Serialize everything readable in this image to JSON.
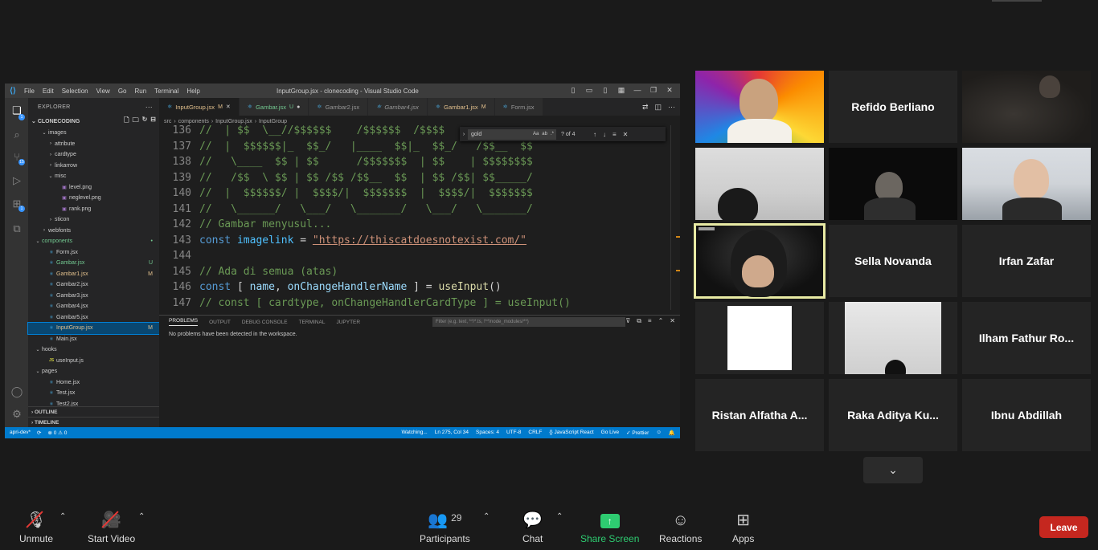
{
  "vscode": {
    "menu": [
      "File",
      "Edit",
      "Selection",
      "View",
      "Go",
      "Run",
      "Terminal",
      "Help"
    ],
    "window_title": "InputGroup.jsx - clonecoding - Visual Studio Code",
    "explorer_title": "EXPLORER",
    "project": "CLONECODING",
    "tree": [
      {
        "label": "images",
        "depth": 2,
        "kind": "folder-open"
      },
      {
        "label": "attribute",
        "depth": 3,
        "kind": "folder"
      },
      {
        "label": "cardtype",
        "depth": 3,
        "kind": "folder"
      },
      {
        "label": "linkarrow",
        "depth": 3,
        "kind": "folder"
      },
      {
        "label": "misc",
        "depth": 3,
        "kind": "folder-open"
      },
      {
        "label": "level.png",
        "depth": 4,
        "kind": "png"
      },
      {
        "label": "neglevel.png",
        "depth": 4,
        "kind": "png"
      },
      {
        "label": "rank.png",
        "depth": 4,
        "kind": "png"
      },
      {
        "label": "sticon",
        "depth": 3,
        "kind": "folder"
      },
      {
        "label": "webfonts",
        "depth": 2,
        "kind": "folder"
      },
      {
        "label": "components",
        "depth": 1,
        "kind": "folder-open",
        "status": "•",
        "state": "folder-mod"
      },
      {
        "label": "Form.jsx",
        "depth": 2,
        "kind": "jsx"
      },
      {
        "label": "Gambar.jsx",
        "depth": 2,
        "kind": "jsx",
        "status": "U",
        "state": "unt"
      },
      {
        "label": "Gambar1.jsx",
        "depth": 2,
        "kind": "jsx",
        "status": "M",
        "state": "mod"
      },
      {
        "label": "Gambar2.jsx",
        "depth": 2,
        "kind": "jsx"
      },
      {
        "label": "Gambar3.jsx",
        "depth": 2,
        "kind": "jsx"
      },
      {
        "label": "Gambar4.jsx",
        "depth": 2,
        "kind": "jsx"
      },
      {
        "label": "Gambar5.jsx",
        "depth": 2,
        "kind": "jsx"
      },
      {
        "label": "InputGroup.jsx",
        "depth": 2,
        "kind": "jsx",
        "status": "M",
        "state": "selected"
      },
      {
        "label": "Main.jsx",
        "depth": 2,
        "kind": "jsx"
      },
      {
        "label": "hooks",
        "depth": 1,
        "kind": "folder-open"
      },
      {
        "label": "useInput.js",
        "depth": 2,
        "kind": "js"
      },
      {
        "label": "pages",
        "depth": 1,
        "kind": "folder-open"
      },
      {
        "label": "Home.jsx",
        "depth": 2,
        "kind": "jsx"
      },
      {
        "label": "Test.jsx",
        "depth": 2,
        "kind": "jsx"
      },
      {
        "label": "Test2.jsx",
        "depth": 2,
        "kind": "jsx"
      }
    ],
    "outline": "OUTLINE",
    "timeline": "TIMELINE",
    "tabs": [
      {
        "label": "InputGroup.jsx",
        "mark": "M",
        "state": "active"
      },
      {
        "label": "Gambar.jsx",
        "mark": "U",
        "state": "unt"
      },
      {
        "label": "Gambar2.jsx",
        "mark": "",
        "state": ""
      },
      {
        "label": "Gambar4.jsx",
        "mark": "",
        "state": "ital"
      },
      {
        "label": "Gambar1.jsx",
        "mark": "M",
        "state": "mod"
      },
      {
        "label": "Form.jsx",
        "mark": "",
        "state": ""
      }
    ],
    "breadcrumb": [
      "src",
      "components",
      "InputGroup.jsx",
      "InputGroup"
    ],
    "find": {
      "query": "gold",
      "count": "? of 4"
    },
    "code_lines": [
      {
        "n": "136",
        "text": "//  | $$  \\__//$$$$$$    /$$$$$$  /$$$$"
      },
      {
        "n": "137",
        "text": "//  |  $$$$$$|_  $$_/   |____  $$|_  $$_/   /$$__  $$"
      },
      {
        "n": "138",
        "text": "//   \\____  $$ | $$      /$$$$$$$  | $$    | $$$$$$$$"
      },
      {
        "n": "139",
        "text": "//   /$$  \\ $$ | $$ /$$ /$$__  $$  | $$ /$$| $$_____/"
      },
      {
        "n": "140",
        "text": "//  |  $$$$$$/ |  $$$$/|  $$$$$$$  |  $$$$/|  $$$$$$$"
      },
      {
        "n": "141",
        "text": "//   \\______/   \\___/   \\_______/   \\___/   \\_______/"
      },
      {
        "n": "142",
        "text": "// Gambar menyusul..."
      },
      {
        "n": "144",
        "text": ""
      },
      {
        "n": "145",
        "text": "// Ada di semua (atas)"
      },
      {
        "n": "147",
        "text": "// const [ cardtype, onChangeHandlerCardType ] = useInput()"
      }
    ],
    "line143": {
      "n": "143",
      "kw": "const",
      "var": "imagelink",
      "op": " = ",
      "str": "\"https://thiscatdoesnotexist.com/\""
    },
    "line146": {
      "n": "146",
      "kw": "const",
      "p1": " [ ",
      "a": "name",
      "p2": ", ",
      "b": "onChangeHandlerName",
      "p3": " ] = ",
      "fn": "useInput",
      "p4": "()"
    },
    "panel_tabs": [
      "PROBLEMS",
      "OUTPUT",
      "DEBUG CONSOLE",
      "TERMINAL",
      "JUPYTER"
    ],
    "panel_filter": "Filter (e.g. text, **/*.ts, !**/node_modules/**)",
    "panel_message": "No problems have been detected in the workspace.",
    "status_left": [
      "apri-dev*",
      "⟳",
      "⊗ 0 ⚠ 0"
    ],
    "status_right": [
      "Watching...",
      "Ln 275, Col 34",
      "Spaces: 4",
      "UTF-8",
      "CRLF",
      "{} JavaScript React",
      "Go Live",
      "✓ Prettier"
    ]
  },
  "participants": [
    {
      "name": "",
      "video": "rainbow"
    },
    {
      "name": "Refido Berliano",
      "video": ""
    },
    {
      "name": "",
      "video": "dim"
    },
    {
      "name": "",
      "video": "light"
    },
    {
      "name": "",
      "video": "dark"
    },
    {
      "name": "",
      "video": "office"
    },
    {
      "name": "",
      "video": "cam",
      "speaking": true
    },
    {
      "name": "Sella Novanda",
      "video": ""
    },
    {
      "name": "Irfan Zafar",
      "video": ""
    },
    {
      "name": "",
      "video": "whitebox"
    },
    {
      "name": "",
      "video": "blur"
    },
    {
      "name": "Ilham Fathur Ro...",
      "video": ""
    },
    {
      "name": "Ristan Alfatha A...",
      "video": ""
    },
    {
      "name": "Raka Aditya Ku...",
      "video": ""
    },
    {
      "name": "Ibnu Abdillah",
      "video": ""
    }
  ],
  "controls": {
    "unmute": "Unmute",
    "start_video": "Start Video",
    "participants": "Participants",
    "participant_count": "29",
    "chat": "Chat",
    "share_screen": "Share Screen",
    "reactions": "Reactions",
    "apps": "Apps",
    "leave": "Leave"
  },
  "colors": {
    "accent_green": "#2ecc71",
    "leave_red": "#c5271f",
    "speaker_outline": "#e8eaa4",
    "vscode_status": "#007acc"
  }
}
